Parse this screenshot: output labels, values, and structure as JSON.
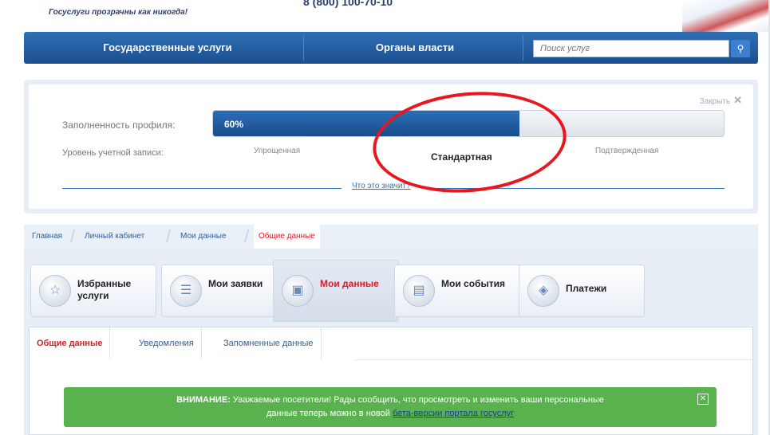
{
  "header": {
    "slogan": "Госуслуги прозрачны как никогда!",
    "phone": "8 (800) 100-70-10"
  },
  "topnav": {
    "items": [
      {
        "label": "Государственные услуги"
      },
      {
        "label": "Органы власти"
      }
    ],
    "search": {
      "placeholder": "Поиск услуг"
    }
  },
  "profile": {
    "close_label": "Закрыть",
    "fill_label": "Заполненность профиля:",
    "fill_percent": 60,
    "fill_percent_text": "60%",
    "level_label": "Уровень учетной записи:",
    "levels": [
      "Упрощенная",
      "Стандартная",
      "Подтвержденная"
    ],
    "active_level": "Стандартная",
    "what_link": "Что это значит?"
  },
  "breadcrumbs": [
    "Главная",
    "Личный кабинет",
    "Мои данные",
    "Общие данные"
  ],
  "tiles": [
    {
      "label": "Избранные услуги",
      "icon": "star-hand-icon"
    },
    {
      "label": "Мои заявки",
      "icon": "list-icon"
    },
    {
      "label": "Мои данные",
      "icon": "profile-card-icon",
      "active": true
    },
    {
      "label": "Мои события",
      "icon": "calendar-icon"
    },
    {
      "label": "Платежи",
      "icon": "payments-icon"
    }
  ],
  "tabs": [
    "Общие данные",
    "Уведомления",
    "Запомненные данные"
  ],
  "alert": {
    "prefix": "ВНИМАНИЕ:",
    "line1": "Уважаемые посетители! Рады сообщить, что просмотреть и изменить ваши персональные",
    "line2": "данные теперь можно в новой",
    "link": "бета-версии портала госуслуг"
  },
  "colors": {
    "brand_blue": "#2f6fb5",
    "accent_red": "#d81e2b",
    "highlight_ellipse": "#e8161d",
    "alert_green": "#5ab24f"
  }
}
